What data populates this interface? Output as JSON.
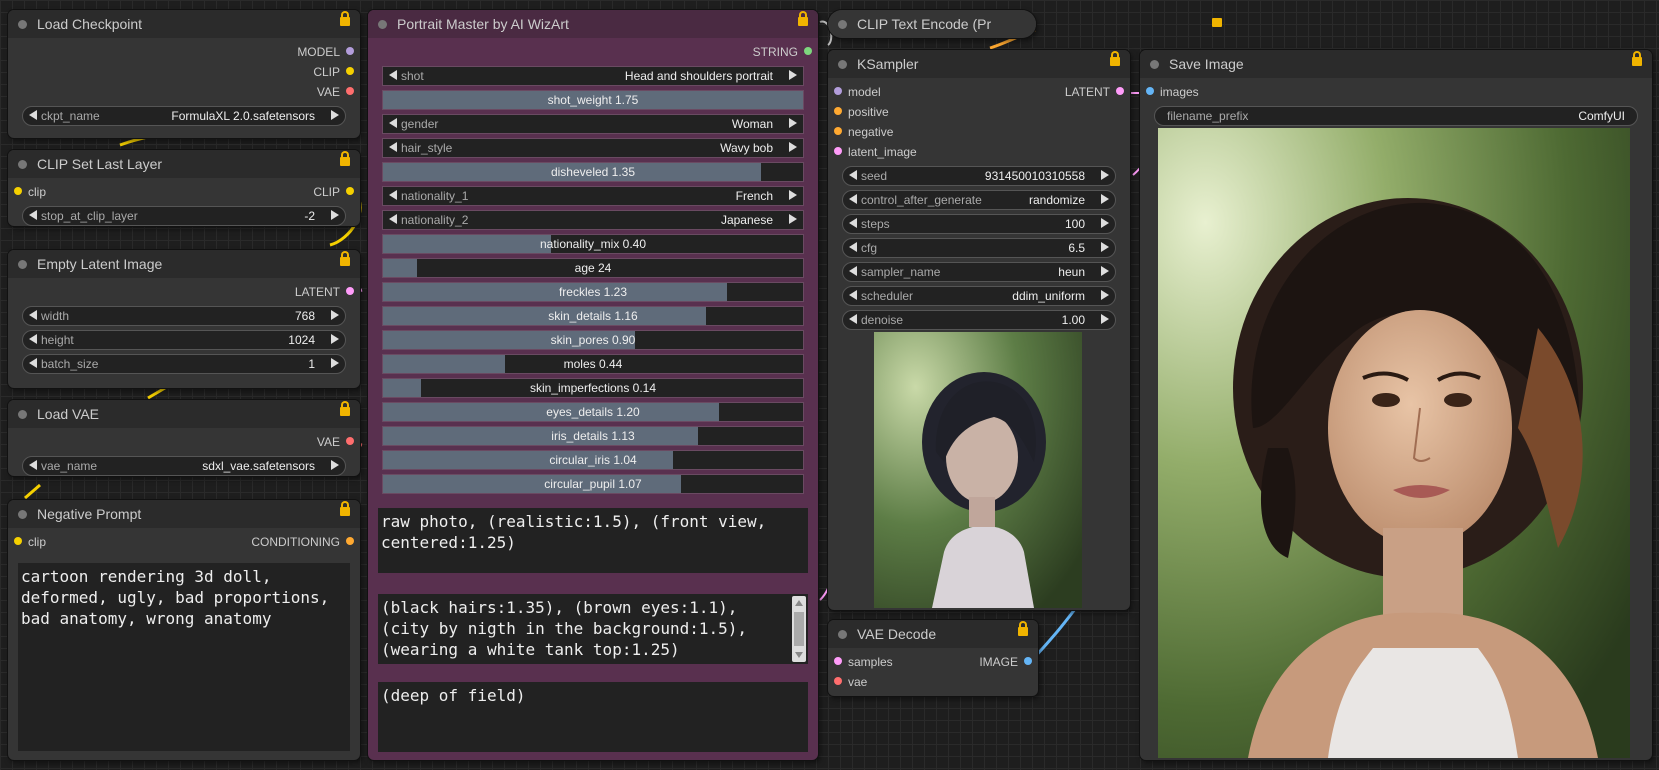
{
  "colors": {
    "model": "#b39ddb",
    "clip": "#f5d000",
    "vae": "#ff6e6e",
    "latent": "#ff9cf9",
    "conditioning": "#ffa931",
    "string": "#7ed67e",
    "image": "#64b5f6"
  },
  "load_checkpoint": {
    "title": "Load Checkpoint",
    "outputs": [
      "MODEL",
      "CLIP",
      "VAE"
    ],
    "widget": {
      "label": "ckpt_name",
      "value": "FormulaXL 2.0.safetensors"
    }
  },
  "clip_set_last_layer": {
    "title": "CLIP Set Last Layer",
    "input": "clip",
    "output": "CLIP",
    "widget": {
      "label": "stop_at_clip_layer",
      "value": "-2"
    }
  },
  "empty_latent": {
    "title": "Empty Latent Image",
    "output": "LATENT",
    "widgets": [
      {
        "label": "width",
        "value": "768"
      },
      {
        "label": "height",
        "value": "1024"
      },
      {
        "label": "batch_size",
        "value": "1"
      }
    ]
  },
  "load_vae": {
    "title": "Load VAE",
    "output": "VAE",
    "widget": {
      "label": "vae_name",
      "value": "sdxl_vae.safetensors"
    }
  },
  "negative_prompt": {
    "title": "Negative Prompt",
    "input": "clip",
    "output": "CONDITIONING",
    "text": "cartoon rendering 3d doll,\ndeformed, ugly, bad proportions,\nbad anatomy, wrong anatomy"
  },
  "portrait_master": {
    "title": "Portrait Master by AI WizArt",
    "output": "STRING",
    "combos": {
      "shot": {
        "label": "shot",
        "value": "Head and shoulders portrait"
      },
      "gender": {
        "label": "gender",
        "value": "Woman"
      },
      "hair_style": {
        "label": "hair_style",
        "value": "Wavy bob"
      },
      "nationality_1": {
        "label": "nationality_1",
        "value": "French"
      },
      "nationality_2": {
        "label": "nationality_2",
        "value": "Japanese"
      }
    },
    "sliders": {
      "shot_weight": {
        "label": "shot_weight  1.75",
        "fraction": 1.0
      },
      "disheveled": {
        "label": "disheveled  1.35",
        "fraction": 0.9
      },
      "nationality_mix": {
        "label": "nationality_mix  0.40",
        "fraction": 0.4
      },
      "age": {
        "label": "age  24",
        "fraction": 0.08
      },
      "freckles": {
        "label": "freckles  1.23",
        "fraction": 0.82
      },
      "skin_details": {
        "label": "skin_details  1.16",
        "fraction": 0.77
      },
      "skin_pores": {
        "label": "skin_pores  0.90",
        "fraction": 0.6
      },
      "moles": {
        "label": "moles  0.44",
        "fraction": 0.29
      },
      "skin_imperfections": {
        "label": "skin_imperfections  0.14",
        "fraction": 0.09
      },
      "eyes_details": {
        "label": "eyes_details  1.20",
        "fraction": 0.8
      },
      "iris_details": {
        "label": "iris_details  1.13",
        "fraction": 0.75
      },
      "circular_iris": {
        "label": "circular_iris  1.04",
        "fraction": 0.69
      },
      "circular_pupil": {
        "label": "circular_pupil  1.07",
        "fraction": 0.71
      }
    },
    "text1": "raw photo, (realistic:1.5), (front view,\ncentered:1.25)",
    "text2": "(black hairs:1.35), (brown eyes:1.1),\n(city by nigth in the background:1.5),\n(wearing a white tank top:1.25)",
    "text3": "(deep of field)"
  },
  "clip_text_encode": {
    "title": "CLIP Text Encode (Pr"
  },
  "ksampler": {
    "title": "KSampler",
    "output": "LATENT",
    "inputs": [
      "model",
      "positive",
      "negative",
      "latent_image"
    ],
    "widgets": {
      "seed": {
        "label": "seed",
        "value": "931450010310558"
      },
      "control": {
        "label": "control_after_generate",
        "value": "randomize"
      },
      "steps": {
        "label": "steps",
        "value": "100"
      },
      "cfg": {
        "label": "cfg",
        "value": "6.5"
      },
      "sampler": {
        "label": "sampler_name",
        "value": "heun"
      },
      "scheduler": {
        "label": "scheduler",
        "value": "ddim_uniform"
      },
      "denoise": {
        "label": "denoise",
        "value": "1.00"
      }
    }
  },
  "vae_decode": {
    "title": "VAE Decode",
    "inputs": [
      "samples",
      "vae"
    ],
    "output": "IMAGE"
  },
  "save_image": {
    "title": "Save Image",
    "input": "images",
    "widget": {
      "label": "filename_prefix",
      "value": "ComfyUI"
    }
  }
}
